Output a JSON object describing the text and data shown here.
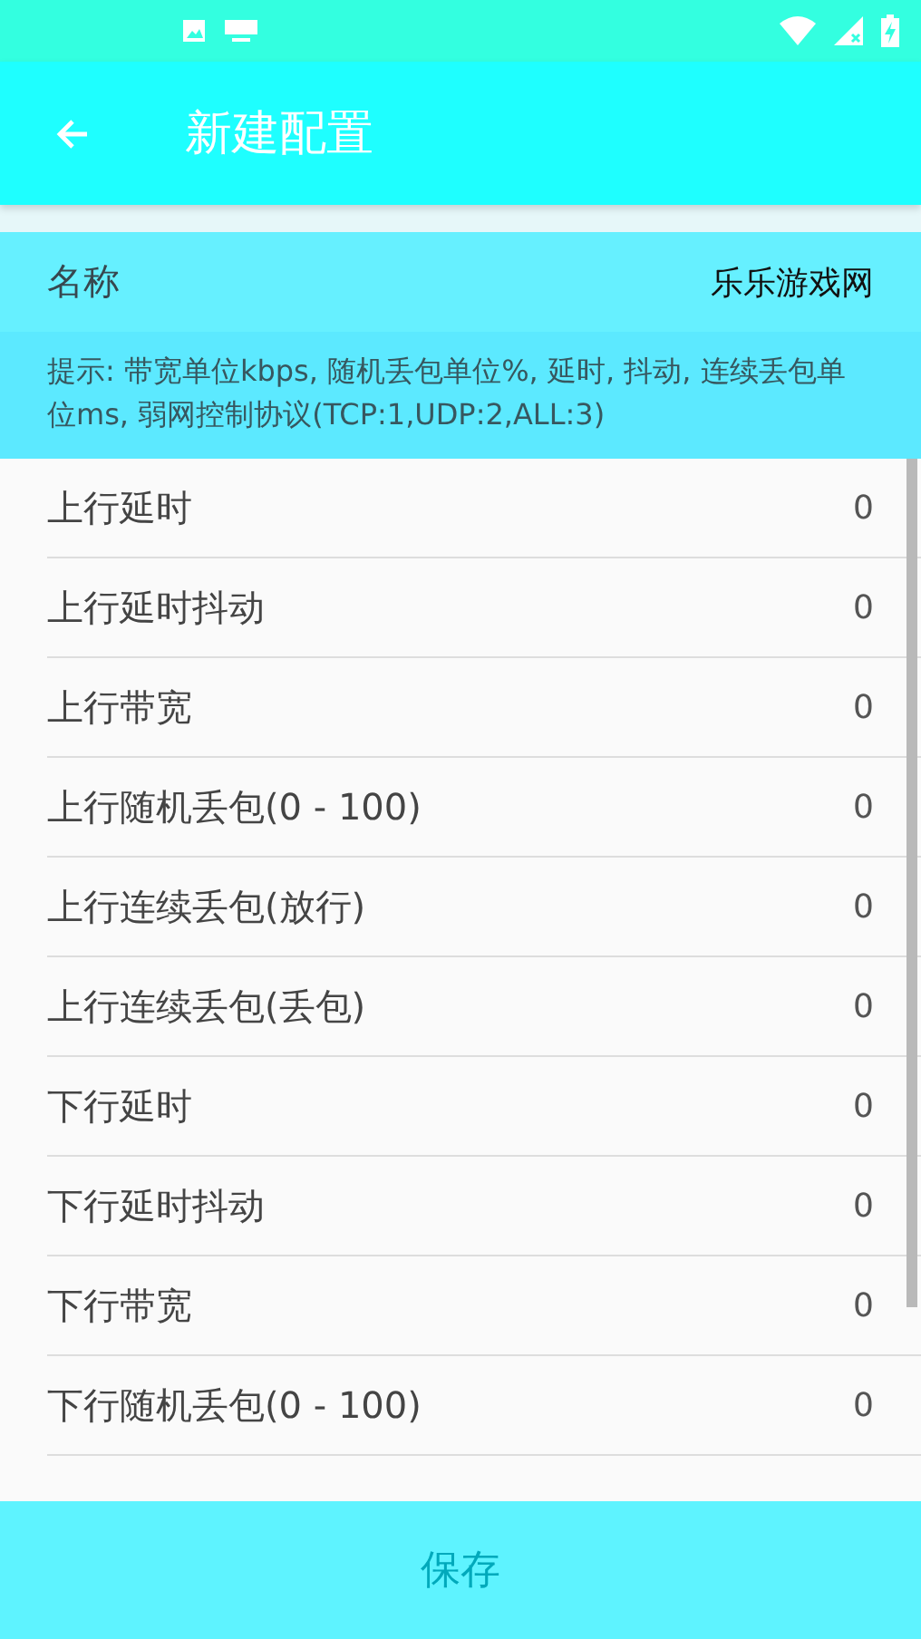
{
  "app_bar": {
    "title": "新建配置"
  },
  "name_field": {
    "label": "名称",
    "value": "乐乐游戏网"
  },
  "hint": "提示: 带宽单位kbps, 随机丢包单位%, 延时, 抖动, 连续丢包单位ms, 弱网控制协议(TCP:1,UDP:2,ALL:3)",
  "settings": [
    {
      "label": "上行延时",
      "value": "0"
    },
    {
      "label": "上行延时抖动",
      "value": "0"
    },
    {
      "label": "上行带宽",
      "value": "0"
    },
    {
      "label": "上行随机丢包(0 - 100)",
      "value": "0"
    },
    {
      "label": "上行连续丢包(放行)",
      "value": "0"
    },
    {
      "label": "上行连续丢包(丢包)",
      "value": "0"
    },
    {
      "label": "下行延时",
      "value": "0"
    },
    {
      "label": "下行延时抖动",
      "value": "0"
    },
    {
      "label": "下行带宽",
      "value": "0"
    },
    {
      "label": "下行随机丢包(0 - 100)",
      "value": "0"
    }
  ],
  "save_button": {
    "label": "保存"
  }
}
